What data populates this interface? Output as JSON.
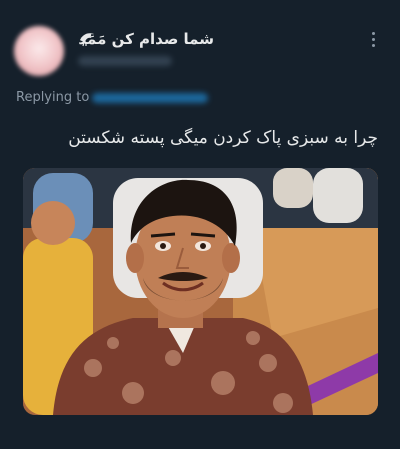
{
  "tweet": {
    "display_name": "شما صدام کن مَمَد",
    "reply_prefix": "Replying to",
    "text": "چرا به سبزی پاک کردن میگی پسته شکستن",
    "media": {
      "type": "photo",
      "description_icon": "photo"
    }
  },
  "icons": {
    "badge": "eagle-icon",
    "menu": "more-options-icon"
  },
  "colors": {
    "background": "#15202b",
    "text": "#e7e9ea",
    "secondary": "#8b98a5",
    "link": "#1d9bf0"
  }
}
